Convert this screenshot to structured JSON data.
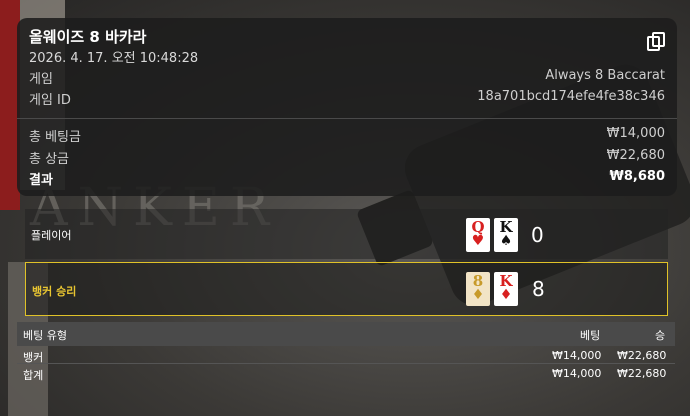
{
  "header": {
    "title": "올웨이즈 8 바카라",
    "datetime": "2026. 4. 17. 오전 10:48:28",
    "copy_icon": "copy-icon"
  },
  "details": {
    "game_label": "게임",
    "game_value": "Always 8 Baccarat",
    "game_id_label": "게임 ID",
    "game_id_value": "18a701bcd174efe4fe38c346"
  },
  "summary": {
    "total_bet_label": "총 베팅금",
    "total_bet_value": "₩14,000",
    "total_win_label": "총 상금",
    "total_win_value": "₩22,680",
    "result_label": "결과",
    "result_value": "₩8,680"
  },
  "background": {
    "table_text": "ANKER"
  },
  "hands": {
    "player": {
      "label": "플레이어",
      "cards": [
        {
          "rank": "Q",
          "suit": "♥"
        },
        {
          "rank": "K",
          "suit": "♠"
        }
      ],
      "score": "0"
    },
    "banker": {
      "label": "뱅커 승리",
      "cards": [
        {
          "rank": "8",
          "suit": "♦"
        },
        {
          "rank": "K",
          "suit": "♦"
        }
      ],
      "score": "8"
    }
  },
  "bets_table": {
    "headers": {
      "type": "베팅 유형",
      "bet": "베팅",
      "win": "승"
    },
    "rows": [
      {
        "type": "뱅커",
        "bet": "₩14,000",
        "win": "₩22,680"
      }
    ],
    "total": {
      "type": "합계",
      "bet": "₩14,000",
      "win": "₩22,680"
    }
  },
  "colors": {
    "highlight": "#e0c228",
    "card_red": "#d82020"
  }
}
